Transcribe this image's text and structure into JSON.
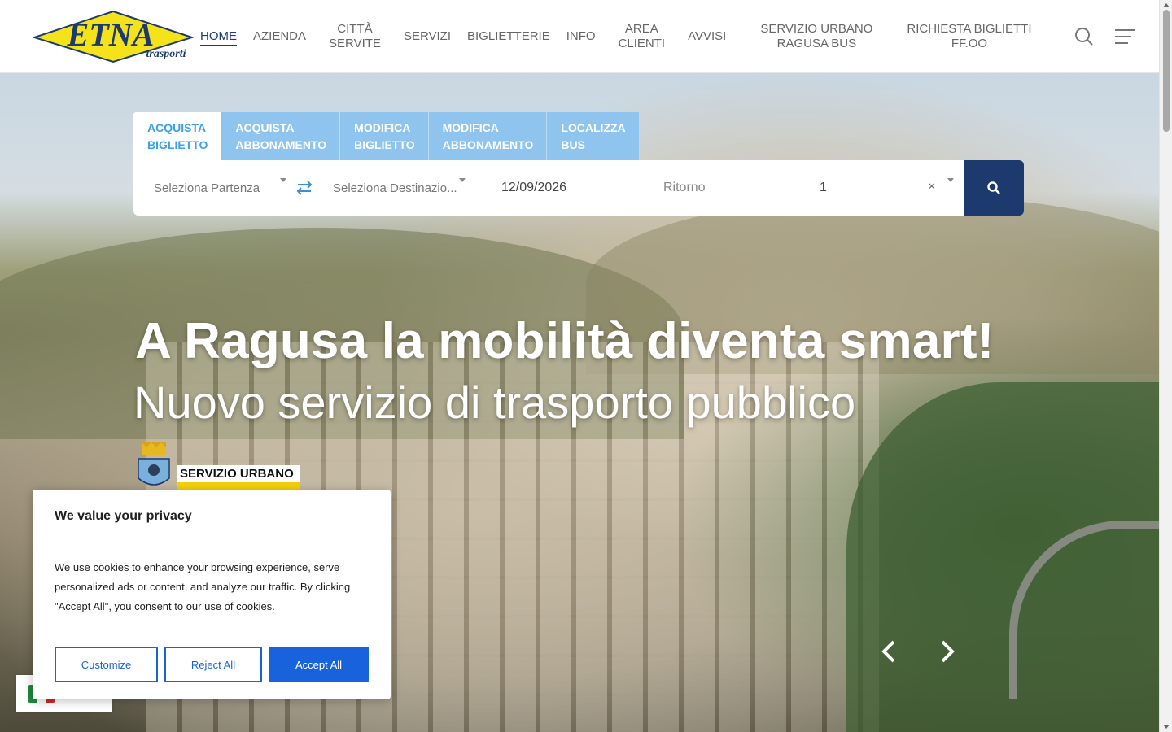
{
  "header": {
    "logo": {
      "brand": "ETNA",
      "tagline": "trasporti"
    },
    "nav": [
      {
        "id": "home",
        "lines": [
          "HOME"
        ],
        "active": true
      },
      {
        "id": "azienda",
        "lines": [
          "AZIENDA"
        ]
      },
      {
        "id": "citta-servite",
        "lines": [
          "CITTÀ",
          "SERVITE"
        ]
      },
      {
        "id": "servizi",
        "lines": [
          "SERVIZI"
        ]
      },
      {
        "id": "biglietterie",
        "lines": [
          "BIGLIETTERIE"
        ]
      },
      {
        "id": "info",
        "lines": [
          "INFO"
        ]
      },
      {
        "id": "area-clienti",
        "lines": [
          "AREA",
          "CLIENTI"
        ]
      },
      {
        "id": "avvisi",
        "lines": [
          "AVVISI"
        ]
      },
      {
        "id": "servizio-urbano",
        "lines": [
          "SERVIZIO URBANO",
          "RAGUSA BUS"
        ]
      },
      {
        "id": "richiesta-biglietti",
        "lines": [
          "RICHIESTA BIGLIETTI",
          "FF.OO"
        ]
      }
    ],
    "icons": {
      "search": "search-icon",
      "menu": "menu-icon"
    }
  },
  "booking": {
    "tabs": [
      {
        "lines": [
          "ACQUISTA",
          "BIGLIETTO"
        ],
        "active": true
      },
      {
        "lines": [
          "ACQUISTA",
          "ABBONAMENTO"
        ]
      },
      {
        "lines": [
          "MODIFICA",
          "BIGLIETTO"
        ]
      },
      {
        "lines": [
          "MODIFICA",
          "ABBONAMENTO"
        ]
      },
      {
        "lines": [
          "LOCALIZZA",
          "BUS"
        ]
      }
    ],
    "departure_placeholder": "Seleziona Partenza",
    "destination_placeholder": "Seleziona Destinazio...",
    "date_value": "12/09/2026",
    "return_placeholder": "Ritorno",
    "passengers_value": "1",
    "clear_symbol": "×"
  },
  "hero": {
    "headline": "A Ragusa la mobilità diventa smart!",
    "subheadline": "Nuovo servizio di trasporto pubblico",
    "badge_text": "SERVIZIO URBANO"
  },
  "cookie": {
    "title": "We value your privacy",
    "text": "We use cookies to enhance your browsing experience, serve personalized ads or content, and analyze our traffic. By clicking \"Accept All\", you consent to our use of cookies.",
    "customize": "Customize",
    "reject": "Reject All",
    "accept": "Accept All"
  },
  "colors": {
    "primary_dark": "#1d3a6e",
    "tab_light": "#8ec4ee",
    "tab_active_text": "#3aa1e6",
    "cookie_blue": "#1863dc",
    "badge_yellow": "#f5d10a"
  }
}
